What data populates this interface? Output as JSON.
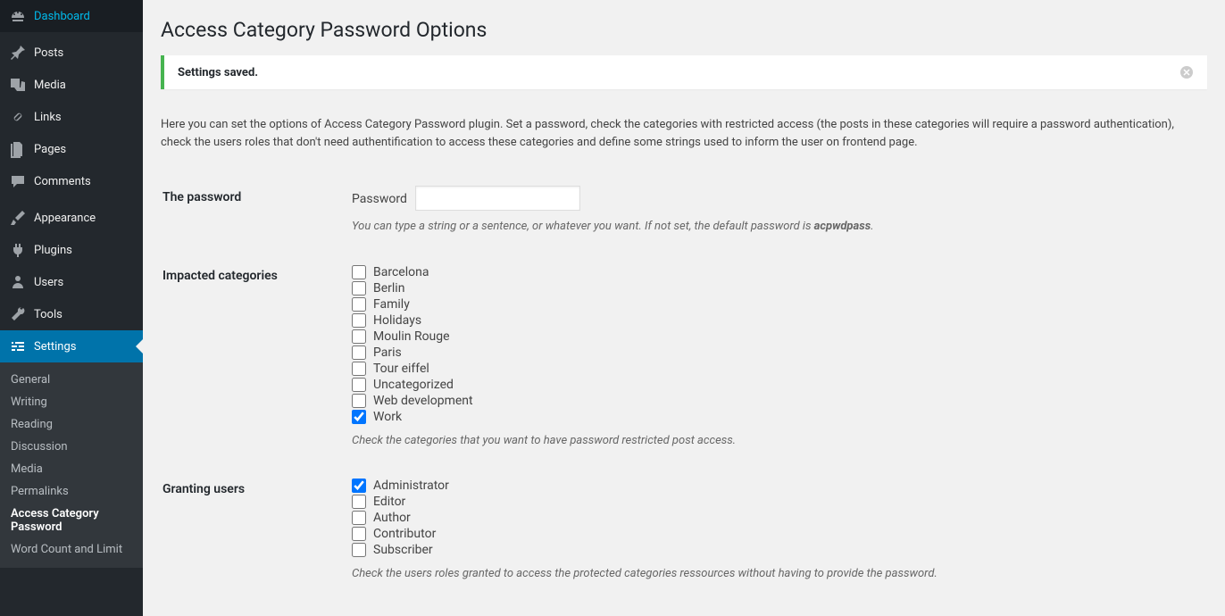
{
  "sidebar": {
    "items": [
      {
        "label": "Dashboard",
        "icon": "dashboard"
      },
      {
        "label": "Posts",
        "icon": "pin"
      },
      {
        "label": "Media",
        "icon": "media"
      },
      {
        "label": "Links",
        "icon": "links"
      },
      {
        "label": "Pages",
        "icon": "pages"
      },
      {
        "label": "Comments",
        "icon": "comments"
      },
      {
        "label": "Appearance",
        "icon": "brush"
      },
      {
        "label": "Plugins",
        "icon": "plug"
      },
      {
        "label": "Users",
        "icon": "users"
      },
      {
        "label": "Tools",
        "icon": "tools"
      },
      {
        "label": "Settings",
        "icon": "settings"
      }
    ],
    "submenu": [
      "General",
      "Writing",
      "Reading",
      "Discussion",
      "Media",
      "Permalinks",
      "Access Category Password",
      "Word Count and Limit"
    ]
  },
  "page": {
    "title": "Access Category Password Options",
    "notice": "Settings saved.",
    "intro": "Here you can set the options of Access Category Password plugin. Set a password, check the categories with restricted access (the posts in these categories will require a password authentication), check the users roles that don't need authentification to access these categories and define some strings used to inform the user on frontend page."
  },
  "form": {
    "password": {
      "th": "The password",
      "label": "Password",
      "value": "",
      "help_prefix": "You can type a string or a sentence, or whatever you want. If not set, the default password is ",
      "help_strong": "acpwdpass",
      "help_suffix": "."
    },
    "categories": {
      "th": "Impacted categories",
      "items": [
        {
          "label": "Barcelona",
          "checked": false
        },
        {
          "label": "Berlin",
          "checked": false
        },
        {
          "label": "Family",
          "checked": false
        },
        {
          "label": "Holidays",
          "checked": false
        },
        {
          "label": "Moulin Rouge",
          "checked": false
        },
        {
          "label": "Paris",
          "checked": false
        },
        {
          "label": "Tour eiffel",
          "checked": false
        },
        {
          "label": "Uncategorized",
          "checked": false
        },
        {
          "label": "Web development",
          "checked": false
        },
        {
          "label": "Work",
          "checked": true
        }
      ],
      "help": "Check the categories that you want to have password restricted post access."
    },
    "users": {
      "th": "Granting users",
      "items": [
        {
          "label": "Administrator",
          "checked": true
        },
        {
          "label": "Editor",
          "checked": false
        },
        {
          "label": "Author",
          "checked": false
        },
        {
          "label": "Contributor",
          "checked": false
        },
        {
          "label": "Subscriber",
          "checked": false
        }
      ],
      "help": "Check the users roles granted to access the protected categories ressources without having to provide the password."
    }
  }
}
